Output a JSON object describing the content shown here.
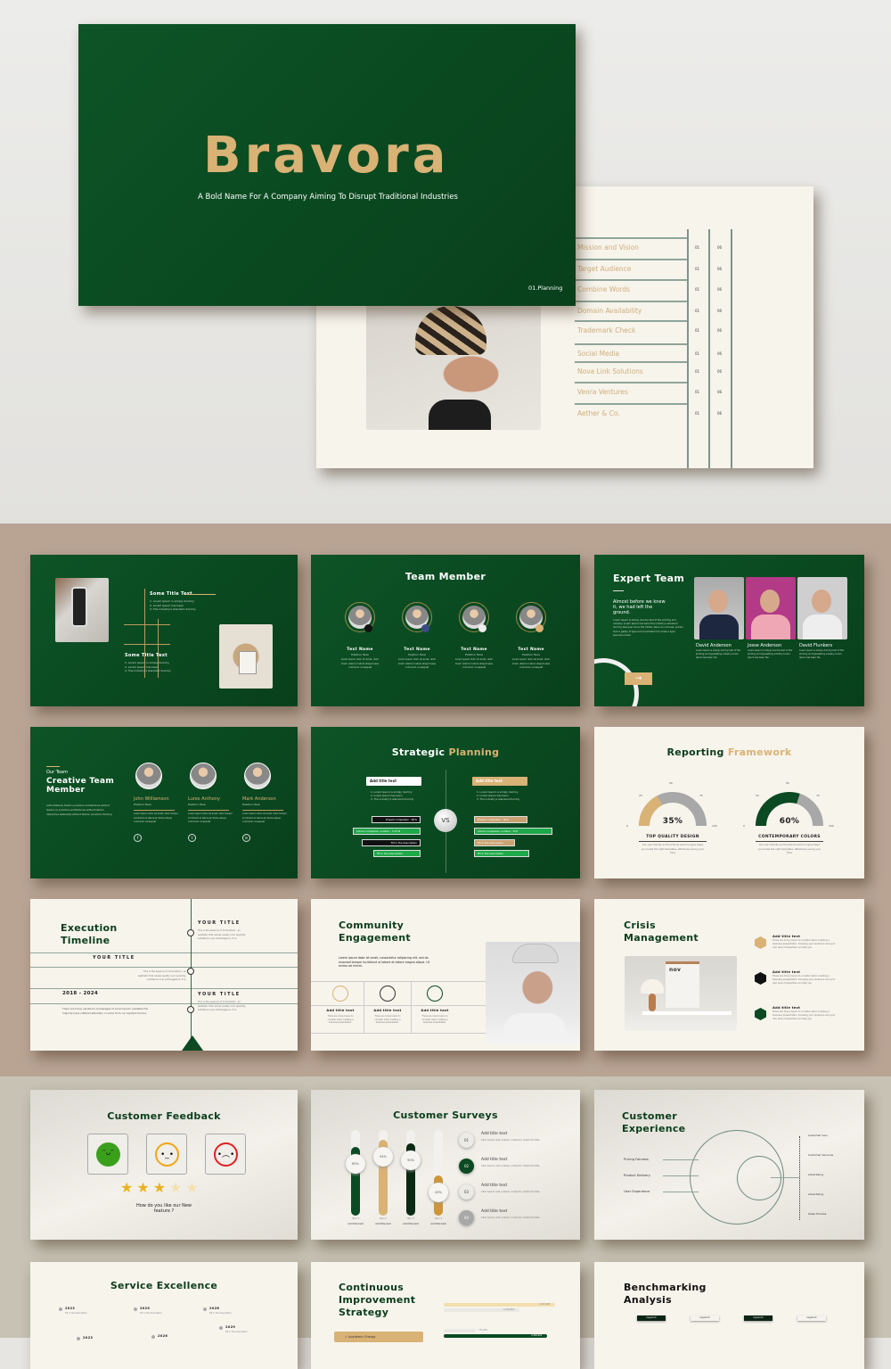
{
  "hero": {
    "title": "Bravora",
    "subtitle": "A Bold Name For A Company Aiming To Disrupt Traditional Industries",
    "section": "01.Planning"
  },
  "agenda": {
    "items": [
      {
        "label": "Mission and Vision",
        "a": "01",
        "b": "06"
      },
      {
        "label": "Target Audience",
        "a": "01",
        "b": "06"
      },
      {
        "label": "Combine Words",
        "a": "01",
        "b": "06"
      },
      {
        "label": "Domain Availability",
        "a": "01",
        "b": "06"
      },
      {
        "label": "Trademark Check",
        "a": "01",
        "b": "06"
      },
      {
        "label": "Social Media",
        "a": "01",
        "b": "06"
      },
      {
        "label": "Nova Link Solutions",
        "a": "01",
        "b": "06"
      },
      {
        "label": "Veora Ventures",
        "a": "01",
        "b": "06"
      },
      {
        "label": "Aether & Co.",
        "a": "01",
        "b": "06"
      }
    ]
  },
  "s_intro": {
    "title1": "Some Title Text",
    "list1": [
      "1. Lorem Ipsum is simply dummy",
      "2. Lorem Ipsum has been",
      "3. The industry's standard dummy"
    ],
    "title2": "Some Title Text",
    "list2": [
      "1. Lorem Ipsum is simply dummy",
      "2. Lorem Ipsum has been",
      "3. The industry's standard dummy"
    ]
  },
  "s_team": {
    "title": "Team Member",
    "members": [
      {
        "name": "Text Name",
        "position": "Position Here",
        "social": "f"
      },
      {
        "name": "Text Name",
        "position": "Position Here",
        "social": "t"
      },
      {
        "name": "Text Name",
        "position": "Position Here",
        "social": "o"
      },
      {
        "name": "Text Name",
        "position": "Position Here",
        "social": "in"
      }
    ],
    "desc": "Lorem ipsum dolor sit amet, dolor lorem ullamco labors aliquot esse commodo consequat"
  },
  "s_expert": {
    "title": "Expert Team",
    "tagline": "Almost before we knew it, we had left the ground.",
    "desc": "Lorem Ipsum is simply dummy text of the printing and industry. Lorem Ipsum has been the industry's standard dummy text ever since the 1500s, when an unknown printer took a galley of type and scrambled it to make a type specimen book.",
    "members": [
      {
        "name": "David Anderson"
      },
      {
        "name": "Josse Anderson"
      },
      {
        "name": "David Flunkers"
      }
    ],
    "member_desc": "Lorem Ipsum is simply dummy text of the printing and typesetting industry Lorem Ipsum has been the",
    "arrow": "→"
  },
  "s_creative": {
    "label": "Our Team",
    "title": "Creative Team Member",
    "desc": "Authoritatively fashion proactive architectures without fashion so proactive architectures without fashion interactive leadership without fashion proactive thinking",
    "members": [
      {
        "name": "John Williamson",
        "position": "Position Here",
        "social": "f"
      },
      {
        "name": "Lures Anthony",
        "position": "Position Here",
        "social": "t"
      },
      {
        "name": "Mark Anderson",
        "position": "Position Here",
        "social": "in"
      }
    ],
    "member_desc": "Lorem ipsum dolor sit amet, dolor tempor incididunt ut labore et dolore aliqua commodo consequat"
  },
  "s_strategy": {
    "title_a": "Strategic",
    "title_b": "Planning",
    "vs": "VS",
    "left": {
      "box": "Add title text",
      "list": [
        "1. Lorem Ipsum is simply dummy",
        "2. Lorem Ipsum has been",
        "3. The industry's standard dummy"
      ],
      "bars": [
        "Project completion : 60%",
        "Actual completion number : 3.33 M",
        "Fill in the description",
        "Fill in the description"
      ]
    },
    "right": {
      "box": "Add title text",
      "list": [
        "1. Lorem Ipsum is simply dummy",
        "2. Lorem Ipsum has been",
        "3. The industry's standard dummy"
      ],
      "bars": [
        "Project completion : 30%",
        "Actual completion number : 8 M",
        "Fill in the description",
        "Fill in the description"
      ]
    }
  },
  "s_report": {
    "title_a": "Reporting",
    "title_b": "Framework",
    "ticks": [
      "0",
      "25",
      "50",
      "75",
      "100"
    ],
    "gauges": [
      {
        "value": 35,
        "label": "35%",
        "title": "TOP QUALITY DESIGN",
        "color": "#d9b275",
        "desc": "Our user friendly and functional search engine helps you locate the right templates, effectively saving your time"
      },
      {
        "value": 60,
        "label": "60%",
        "title": "CONTEMPORARY COLORS",
        "color": "#0b4a22",
        "desc": "Our user friendly and functional search engine helps you locate the right templates, effectively saving your time"
      }
    ]
  },
  "s_timeline": {
    "title": "Execution Timeline",
    "years": "2018 - 2024",
    "items": [
      {
        "title": "YOUR TITLE",
        "desc": "This is the essence of minimalism - an aesthetic that values quality over quantity, substance over extravagance. It is."
      },
      {
        "title": "YOUR TITLE",
        "desc": "This is the essence of minimalism - an aesthetic that values quality over quantity, substance over extravagance. It is."
      },
      {
        "title": "YOUR TITLE",
        "desc": "This is the essence of minimalism - an aesthetic that values quality over quantity, substance over extravagance. It is."
      }
    ],
    "body": "There are many variations of passages of Lorem Ipsum available the majority have suffered alteration in some form, by injected humour."
  },
  "s_community": {
    "title": "Community Engagement",
    "body": "Lorem ipsum dolor sit amet, consectetur adipiscing elit, sed do eiusmod tempor incididunt ut labore et dolore magna aliqua. Ut enimo ad minim.",
    "cols": [
      {
        "title": "Add title text",
        "desc": "There are many topics to consider when creating a business presentation."
      },
      {
        "title": "Add title text",
        "desc": "There are many topics to consider when creating a business presentation."
      },
      {
        "title": "Add title text",
        "desc": "There are many topics to consider when creating a business presentation."
      }
    ]
  },
  "s_crisis": {
    "title": "Crisis Management",
    "calendar": "nov",
    "items": [
      {
        "title": "Add title text",
        "desc": "There are many topics to consider when creating a business presentation. Knowing your audience and your own area of expertise can help you",
        "color": "#d9b275"
      },
      {
        "title": "Add title text",
        "desc": "There are many topics to consider when creating a business presentation. Knowing your audience and your own area of expertise can help you",
        "color": "#111111"
      },
      {
        "title": "Add title text",
        "desc": "There are many topics to consider when creating a business presentation. Knowing your audience and your own area of expertise can help you",
        "color": "#0b4a22"
      }
    ]
  },
  "s_feedback": {
    "title": "Customer Feedback",
    "faces": [
      {
        "mood": "happy",
        "color": "#3aa01c"
      },
      {
        "mood": "neutral",
        "color": "#f2a516"
      },
      {
        "mood": "sad",
        "color": "#e02020"
      }
    ],
    "rating": 3,
    "max_rating": 5,
    "question": "How do you like our New feature ?"
  },
  "s_surveys": {
    "title": "Customer Surveys",
    "bars": [
      {
        "value": 85,
        "label": "85%",
        "item": "Item 1",
        "caption": "Add title text",
        "color": "#0b4a22"
      },
      {
        "value": 95,
        "label": "95%",
        "item": "Item 2",
        "caption": "Add title text",
        "color": "#d9b275"
      },
      {
        "value": 90,
        "label": "90%",
        "item": "Item 3",
        "caption": "Add title text",
        "color": "#0a2a14"
      },
      {
        "value": 45,
        "label": "45%",
        "item": "Item 4",
        "caption": "Add title text",
        "color": "#cf9638"
      }
    ],
    "steps": [
      {
        "num": "01",
        "title": "Add title text",
        "desc": "Click here to add content, content to match the title."
      },
      {
        "num": "02",
        "title": "Add title text",
        "desc": "Click here to add content, content to match the title."
      },
      {
        "num": "03",
        "title": "Add title text",
        "desc": "Click here to add content, content to match the title."
      },
      {
        "num": "04",
        "title": "Add title text",
        "desc": "Click here to add content, content to match the title."
      }
    ]
  },
  "s_experience": {
    "title": "Customer Experience",
    "left": [
      "Pricing Fairness",
      "Product Delivery",
      "User Experience"
    ],
    "right": [
      "Customer Gen",
      "Customer Services",
      "Advertising",
      "Advertising",
      "Sales Process"
    ]
  },
  "s_service": {
    "title": "Service Excellence",
    "items": [
      {
        "year": "2022",
        "desc": "Fill in the description"
      },
      {
        "year": "2025",
        "desc": "Fill in the description"
      },
      {
        "year": "2028",
        "desc": "Fill in the description"
      },
      {
        "year": "2029",
        "desc": "Fill in the description"
      },
      {
        "year": "2023",
        "desc": ""
      },
      {
        "year": "2026",
        "desc": ""
      }
    ]
  },
  "s_continuous": {
    "title": "Continuous Improvement Strategy",
    "tag": "✓ Academic Energy",
    "bars": [
      "3,453,446",
      "2,356,843",
      "735,092",
      "3,346,934"
    ]
  },
  "s_bench": {
    "title": "Benchmarking Analysis",
    "keywords": [
      "keyword",
      "keyword",
      "keyword",
      "keyword"
    ]
  }
}
